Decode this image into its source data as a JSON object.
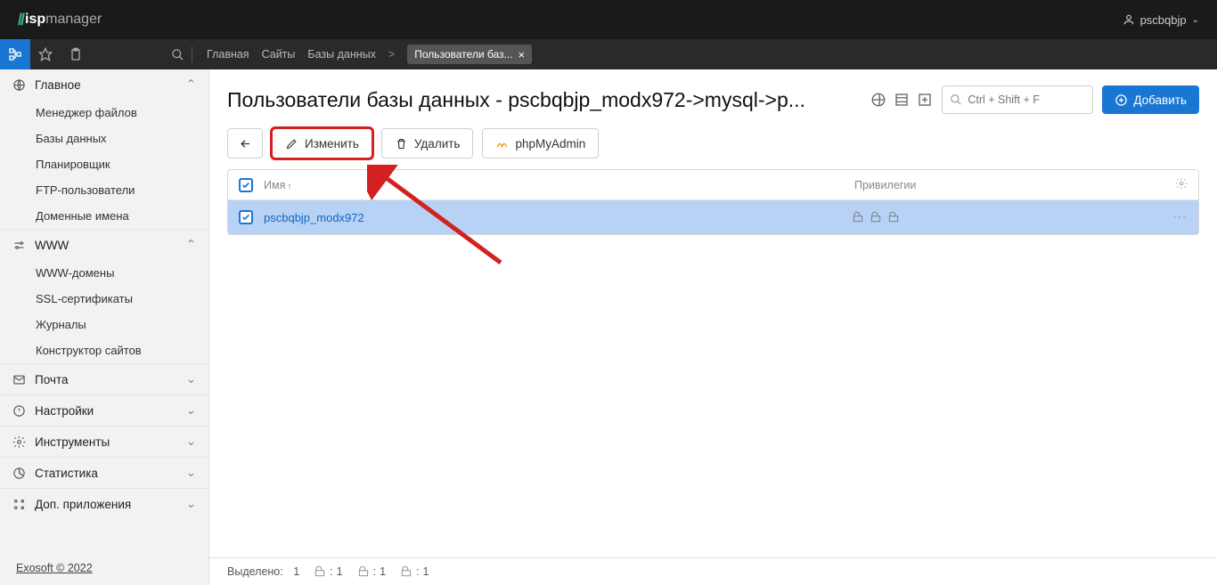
{
  "header": {
    "logo_prefix": "isp",
    "logo_suffix": "manager",
    "user": "pscbqbjp"
  },
  "breadcrumbs": {
    "items": [
      "Главная",
      "Сайты",
      "Базы данных"
    ],
    "active_tab": "Пользователи баз..."
  },
  "sidebar": {
    "groups": [
      {
        "label": "Главное",
        "expanded": true,
        "items": [
          "Менеджер файлов",
          "Базы данных",
          "Планировщик",
          "FTP-пользователи",
          "Доменные имена"
        ]
      },
      {
        "label": "WWW",
        "expanded": true,
        "items": [
          "WWW-домены",
          "SSL-сертификаты",
          "Журналы",
          "Конструктор сайтов"
        ]
      },
      {
        "label": "Почта",
        "expanded": false,
        "items": []
      },
      {
        "label": "Настройки",
        "expanded": false,
        "items": []
      },
      {
        "label": "Инструменты",
        "expanded": false,
        "items": []
      },
      {
        "label": "Статистика",
        "expanded": false,
        "items": []
      },
      {
        "label": "Доп. приложения",
        "expanded": false,
        "items": []
      }
    ],
    "footer": "Exosoft © 2022"
  },
  "page": {
    "title": "Пользователи базы данных - pscbqbjp_modx972->mysql->p...",
    "search_placeholder": "Ctrl + Shift + F",
    "add_label": "Добавить"
  },
  "toolbar": {
    "back_label": "←",
    "edit_label": "Изменить",
    "delete_label": "Удалить",
    "phpma_label": "phpMyAdmin"
  },
  "table": {
    "columns": {
      "name": "Имя",
      "priv": "Привилегии"
    },
    "rows": [
      {
        "name": "pscbqbjp_modx972"
      }
    ]
  },
  "status": {
    "selected_label": "Выделено:",
    "selected_count": "1",
    "counts": [
      "1",
      "1",
      "1"
    ]
  }
}
